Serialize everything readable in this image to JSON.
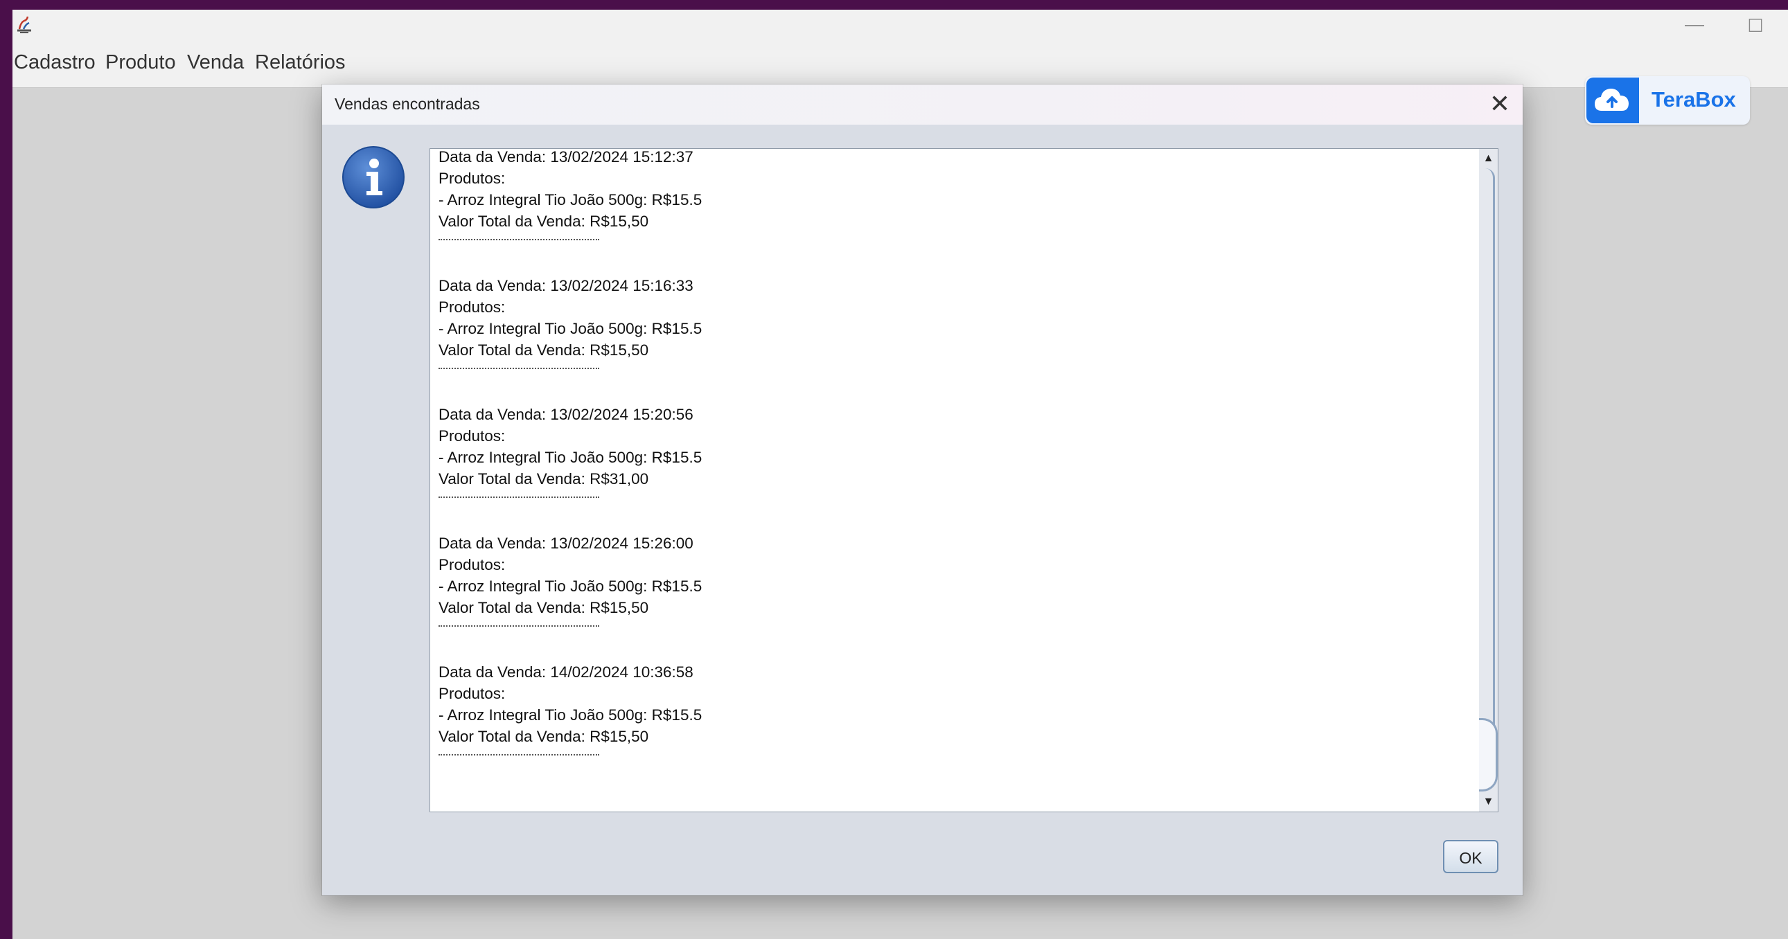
{
  "menubar": {
    "items": [
      "Cadastro",
      "Produto",
      "Venda",
      "Relatórios"
    ]
  },
  "window_controls": {
    "minimize": "—",
    "maximize": "☐"
  },
  "terabox": {
    "label": "TeraBox"
  },
  "dialog": {
    "title": "Vendas encontradas",
    "close": "✕",
    "ok_label": "OK",
    "sales": [
      {
        "date": "Data da Venda: 13/02/2024 15:12:37",
        "products_label": "Produtos:",
        "item": "- Arroz Integral Tio João 500g: R$15.5",
        "total": "Valor Total da Venda: R$15,50"
      },
      {
        "date": "Data da Venda: 13/02/2024 15:16:33",
        "products_label": "Produtos:",
        "item": "- Arroz Integral Tio João 500g: R$15.5",
        "total": "Valor Total da Venda: R$15,50"
      },
      {
        "date": "Data da Venda: 13/02/2024 15:20:56",
        "products_label": "Produtos:",
        "item": "- Arroz Integral Tio João 500g: R$15.5",
        "total": "Valor Total da Venda: R$31,00"
      },
      {
        "date": "Data da Venda: 13/02/2024 15:26:00",
        "products_label": "Produtos:",
        "item": "- Arroz Integral Tio João 500g: R$15.5",
        "total": "Valor Total da Venda: R$15,50"
      },
      {
        "date": "Data da Venda: 14/02/2024 10:36:58",
        "products_label": "Produtos:",
        "item": "- Arroz Integral Tio João 500g: R$15.5",
        "total": "Valor Total da Venda: R$15,50"
      }
    ]
  },
  "icons": {
    "app": "java-app-icon",
    "info": "info-icon",
    "cloud": "cloud-upload-icon"
  },
  "colors": {
    "desktop": "#4a0f4a",
    "accent": "#1a73e8",
    "info_blue": "#2f63b5"
  }
}
